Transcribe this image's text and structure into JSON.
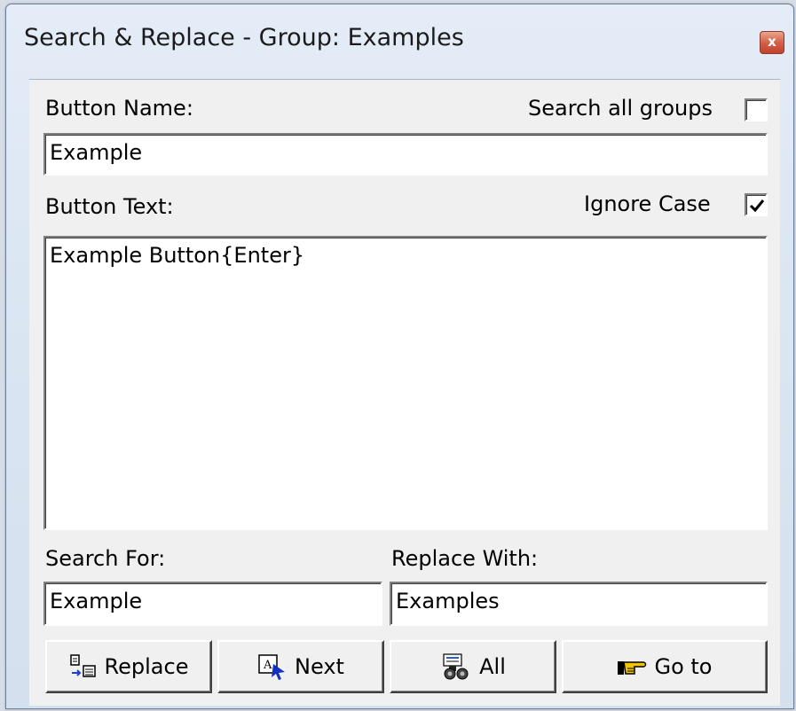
{
  "window": {
    "title": "Search & Replace - Group: Examples",
    "close_glyph": "x"
  },
  "form": {
    "button_name_label": "Button Name:",
    "search_all_groups_label": "Search all groups",
    "search_all_groups_checked": false,
    "button_name_value": "Example",
    "button_text_label": "Button Text:",
    "ignore_case_label": "Ignore Case",
    "ignore_case_checked": true,
    "button_text_value": "Example Button{Enter}",
    "search_for_label": "Search For:",
    "search_for_value": "Example",
    "replace_with_label": "Replace With:",
    "replace_with_value": "Examples"
  },
  "buttons": [
    {
      "label": "Replace",
      "icon": "replace-icon"
    },
    {
      "label": "Next",
      "icon": "next-icon"
    },
    {
      "label": "All",
      "icon": "binoculars-icon"
    },
    {
      "label": "Go to",
      "icon": "pointing-hand-icon"
    }
  ]
}
